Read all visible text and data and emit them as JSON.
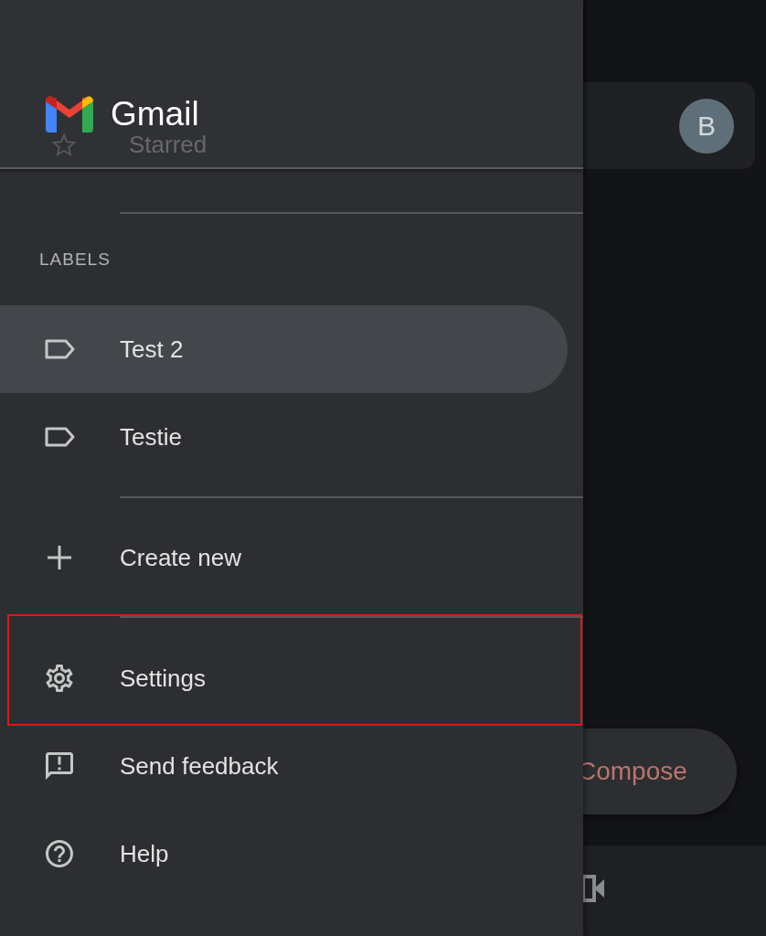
{
  "app_bar": {
    "avatar": "B"
  },
  "drawer": {
    "title": "Gmail",
    "behind_item": {
      "label": "Starred"
    },
    "labels_heading": "LABELS",
    "labels": [
      {
        "label": "Test 2",
        "selected": true
      },
      {
        "label": "Testie",
        "selected": false
      }
    ],
    "actions": [
      {
        "kind": "add",
        "label": "Create new",
        "highlighted": false
      },
      {
        "kind": "settings",
        "label": "Settings",
        "highlighted": true
      },
      {
        "kind": "feedback",
        "label": "Send feedback",
        "highlighted": false
      },
      {
        "kind": "help",
        "label": "Help",
        "highlighted": false
      }
    ]
  },
  "compose": {
    "label": "Compose"
  }
}
